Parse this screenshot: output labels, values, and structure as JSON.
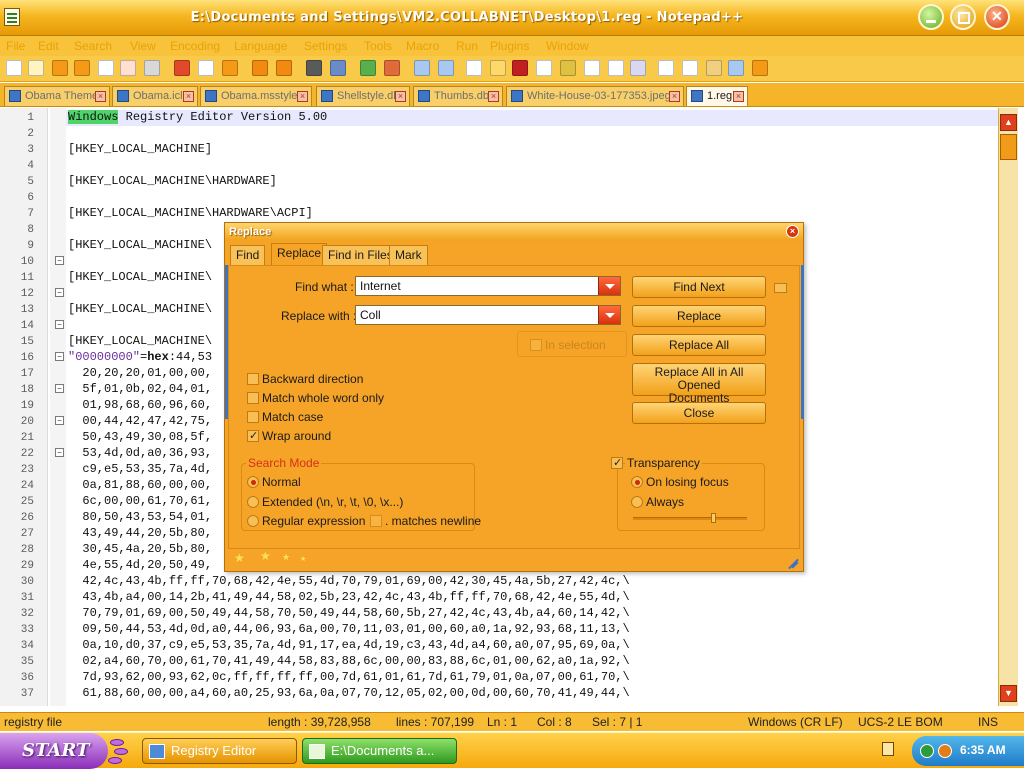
{
  "window": {
    "title": "E:\\Documents and Settings\\VM2.COLLABNET\\Desktop\\1.reg - Notepad++"
  },
  "menu": [
    "File",
    "Edit",
    "Search",
    "View",
    "Encoding",
    "Language",
    "Settings",
    "Tools",
    "Macro",
    "Run",
    "Plugins",
    "Window"
  ],
  "tabs": [
    {
      "label": "Obama Theme"
    },
    {
      "label": "Obama.icl"
    },
    {
      "label": "Obama.msstyles"
    },
    {
      "label": "Shellstyle.dll"
    },
    {
      "label": "Thumbs.db"
    },
    {
      "label": "White-House-03-177353.jpeg"
    },
    {
      "label": "1.reg"
    }
  ],
  "editor": {
    "line_numbers": [
      "1",
      "2",
      "3",
      "4",
      "5",
      "6",
      "7",
      "8",
      "9",
      "10",
      "11",
      "12",
      "13",
      "14",
      "15",
      "16",
      "17",
      "18",
      "19",
      "20",
      "21",
      "22",
      "23",
      "24",
      "25",
      "26",
      "27",
      "28",
      "29",
      "30",
      "31",
      "32",
      "33",
      "34",
      "35",
      "36",
      "37"
    ],
    "header_word": "Windows",
    "header_rest": " Registry Editor Version 5.00",
    "key_lines": {
      "l3": "[HKEY_LOCAL_MACHINE]",
      "l5": "[HKEY_LOCAL_MACHINE\\HARDWARE]",
      "l7": "[HKEY_LOCAL_MACHINE\\HARDWARE\\ACPI]",
      "l9": "[HKEY_LOCAL_MACHINE\\",
      "l11": "[HKEY_LOCAL_MACHINE\\",
      "l13": "[HKEY_LOCAL_MACHINE\\",
      "l15": "[HKEY_LOCAL_MACHINE\\"
    },
    "value_line": {
      "name": "\"00000000\"",
      "eq": "=",
      "type": "hex",
      "data": ":44,53"
    },
    "data_lines": {
      "l17": "  20,20,20,01,00,00,",
      "l18": "  5f,01,0b,02,04,01,",
      "l19": "  01,98,68,60,96,60,",
      "l20": "  00,44,42,47,42,75,",
      "l21": "  50,43,49,30,08,5f,",
      "l22": "  53,4d,0d,a0,36,93,",
      "l23": "  c9,e5,53,35,7a,4d,",
      "l24": "  0a,81,88,60,00,00,",
      "l25": "  6c,00,00,61,70,61,",
      "l26": "  80,50,43,53,54,01,",
      "l27": "  43,49,44,20,5b,80,",
      "l28": "  30,45,4a,20,5b,80,",
      "l29": "  4e,55,4d,20,50,49,",
      "l30": "  42,4c,43,4b,ff,ff,70,68,42,4e,55,4d,70,79,01,69,00,42,30,45,4a,5b,27,42,4c,\\",
      "l31": "  43,4b,a4,00,14,2b,41,49,44,58,02,5b,23,42,4c,43,4b,ff,ff,70,68,42,4e,55,4d,\\",
      "l32": "  70,79,01,69,00,50,49,44,58,70,50,49,44,58,60,5b,27,42,4c,43,4b,a4,60,14,42,\\",
      "l33": "  09,50,44,53,4d,0d,a0,44,06,93,6a,00,70,11,03,01,00,60,a0,1a,92,93,68,11,13,\\",
      "l34": "  0a,10,d0,37,c9,e5,53,35,7a,4d,91,17,ea,4d,19,c3,43,4d,a4,60,a0,07,95,69,0a,\\",
      "l35": "  02,a4,60,70,00,61,70,41,49,44,58,83,88,6c,00,00,83,88,6c,01,00,62,a0,1a,92,\\",
      "l36": "  7d,93,62,00,93,62,0c,ff,ff,ff,ff,00,7d,61,01,61,7d,61,79,01,0a,07,00,61,70,\\",
      "l37": "  61,88,60,00,00,a4,60,a0,25,93,6a,0a,07,70,12,05,02,00,0d,00,60,70,41,49,44,\\"
    }
  },
  "dialog": {
    "title": "Replace",
    "tabs": [
      "Find",
      "Replace",
      "Find in Files",
      "Mark"
    ],
    "find_what_label": "Find what :",
    "find_what_value": "Internet",
    "replace_with_label": "Replace with :",
    "replace_with_value": "Coll",
    "buttons": {
      "find_next": "Find Next",
      "replace": "Replace",
      "replace_all": "Replace All",
      "replace_all_opened_line1": "Replace All in All Opened",
      "replace_all_opened_line2": "Documents",
      "close": "Close"
    },
    "in_selection": "In selection",
    "options": {
      "backward": "Backward direction",
      "whole_word": "Match whole word only",
      "match_case": "Match case",
      "wrap_around": "Wrap around"
    },
    "search_mode": {
      "title": "Search Mode",
      "normal": "Normal",
      "extended": "Extended (\\n, \\r, \\t, \\0, \\x...)",
      "regex": "Regular expression",
      "matches_newline": ". matches newline"
    },
    "transparency": {
      "title": "Transparency",
      "on_losing_focus": "On losing focus",
      "always": "Always"
    },
    "state": {
      "wrap_around_checked": true,
      "transparency_checked": true,
      "search_mode": "Normal",
      "transparency_mode": "On losing focus"
    }
  },
  "statusbar": {
    "file_type": "registry file",
    "length": "length : 39,728,958",
    "lines": "lines : 707,199",
    "ln": "Ln : 1",
    "col": "Col : 8",
    "sel": "Sel : 7 | 1",
    "eol": "Windows (CR LF)",
    "encoding": "UCS-2 LE BOM",
    "ins": "INS"
  },
  "taskbar": {
    "start": "START",
    "tasks": [
      "Registry Editor",
      "E:\\Documents a..."
    ],
    "clock": "6:35 AM"
  },
  "colors": {
    "title_bar": "#f6b620",
    "editor_bg": "#ffffff",
    "dialog_bg": "#f6a428",
    "accent_blue": "#3b73c6",
    "find_highlight": "#4fd46a"
  },
  "icons": [
    "notepad-app-icon",
    "minimize-icon",
    "maximize-icon",
    "close-icon",
    "document-icon",
    "dropdown-arrow-icon",
    "resize-grip-icon",
    "network-icon",
    "volume-icon"
  ]
}
